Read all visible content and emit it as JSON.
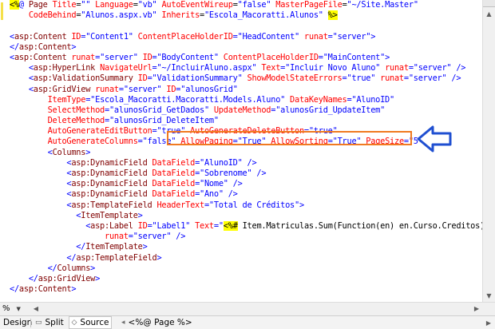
{
  "editor": {
    "lines": [
      [
        {
          "c": "del",
          "t": "<%"
        },
        {
          "c": "kw",
          "t": "@"
        },
        {
          "c": "txt",
          "t": " "
        },
        {
          "c": "tag",
          "t": "Page"
        },
        {
          "c": "txt",
          "t": " "
        },
        {
          "c": "attr",
          "t": "Title"
        },
        {
          "c": "txt",
          "t": "="
        },
        {
          "c": "val",
          "t": "\"\""
        },
        {
          "c": "txt",
          "t": " "
        },
        {
          "c": "attr",
          "t": "Language"
        },
        {
          "c": "txt",
          "t": "="
        },
        {
          "c": "val",
          "t": "\"vb\""
        },
        {
          "c": "txt",
          "t": " "
        },
        {
          "c": "attr",
          "t": "AutoEventWireup"
        },
        {
          "c": "txt",
          "t": "="
        },
        {
          "c": "val",
          "t": "\"false\""
        },
        {
          "c": "txt",
          "t": " "
        },
        {
          "c": "attr",
          "t": "MasterPageFile"
        },
        {
          "c": "txt",
          "t": "="
        },
        {
          "c": "val",
          "t": "\"~/Site.Master\""
        }
      ],
      [
        {
          "c": "txt",
          "t": "    "
        },
        {
          "c": "attr",
          "t": "CodeBehind"
        },
        {
          "c": "txt",
          "t": "="
        },
        {
          "c": "val",
          "t": "\"Alunos.aspx.vb\""
        },
        {
          "c": "txt",
          "t": " "
        },
        {
          "c": "attr",
          "t": "Inherits"
        },
        {
          "c": "txt",
          "t": "="
        },
        {
          "c": "val",
          "t": "\"Escola_Macoratti.Alunos\""
        },
        {
          "c": "txt",
          "t": " "
        },
        {
          "c": "del",
          "t": "%>"
        }
      ],
      [],
      [
        {
          "c": "kw",
          "t": "<"
        },
        {
          "c": "tag",
          "t": "asp:Content"
        },
        {
          "c": "txt",
          "t": " "
        },
        {
          "c": "attr",
          "t": "ID"
        },
        {
          "c": "kw",
          "t": "="
        },
        {
          "c": "val",
          "t": "\"Content1\""
        },
        {
          "c": "txt",
          "t": " "
        },
        {
          "c": "attr",
          "t": "ContentPlaceHolderID"
        },
        {
          "c": "kw",
          "t": "="
        },
        {
          "c": "val",
          "t": "\"HeadContent\""
        },
        {
          "c": "txt",
          "t": " "
        },
        {
          "c": "attr",
          "t": "runat"
        },
        {
          "c": "kw",
          "t": "="
        },
        {
          "c": "val",
          "t": "\"server\""
        },
        {
          "c": "kw",
          "t": ">"
        }
      ],
      [
        {
          "c": "kw",
          "t": "</"
        },
        {
          "c": "tag",
          "t": "asp:Content"
        },
        {
          "c": "kw",
          "t": ">"
        }
      ],
      [
        {
          "c": "kw",
          "t": "<"
        },
        {
          "c": "tag",
          "t": "asp:Content"
        },
        {
          "c": "txt",
          "t": " "
        },
        {
          "c": "attr",
          "t": "runat"
        },
        {
          "c": "kw",
          "t": "="
        },
        {
          "c": "val",
          "t": "\"server\""
        },
        {
          "c": "txt",
          "t": " "
        },
        {
          "c": "attr",
          "t": "ID"
        },
        {
          "c": "kw",
          "t": "="
        },
        {
          "c": "val",
          "t": "\"BodyContent\""
        },
        {
          "c": "txt",
          "t": " "
        },
        {
          "c": "attr",
          "t": "ContentPlaceHolderID"
        },
        {
          "c": "kw",
          "t": "="
        },
        {
          "c": "val",
          "t": "\"MainContent\""
        },
        {
          "c": "kw",
          "t": ">"
        }
      ],
      [
        {
          "c": "txt",
          "t": "    "
        },
        {
          "c": "kw",
          "t": "<"
        },
        {
          "c": "tag",
          "t": "asp:HyperLink"
        },
        {
          "c": "txt",
          "t": " "
        },
        {
          "c": "attr",
          "t": "NavigateUrl"
        },
        {
          "c": "kw",
          "t": "="
        },
        {
          "c": "val",
          "t": "\"~/IncluirAluno.aspx\""
        },
        {
          "c": "txt",
          "t": " "
        },
        {
          "c": "attr",
          "t": "Text"
        },
        {
          "c": "kw",
          "t": "="
        },
        {
          "c": "val",
          "t": "\"Incluir Novo Aluno\""
        },
        {
          "c": "txt",
          "t": " "
        },
        {
          "c": "attr",
          "t": "runat"
        },
        {
          "c": "kw",
          "t": "="
        },
        {
          "c": "val",
          "t": "\"server\""
        },
        {
          "c": "txt",
          "t": " "
        },
        {
          "c": "kw",
          "t": "/>"
        }
      ],
      [
        {
          "c": "txt",
          "t": "    "
        },
        {
          "c": "kw",
          "t": "<"
        },
        {
          "c": "tag",
          "t": "asp:ValidationSummary"
        },
        {
          "c": "txt",
          "t": " "
        },
        {
          "c": "attr",
          "t": "ID"
        },
        {
          "c": "kw",
          "t": "="
        },
        {
          "c": "val",
          "t": "\"ValidationSummary\""
        },
        {
          "c": "txt",
          "t": " "
        },
        {
          "c": "attr",
          "t": "ShowModelStateErrors"
        },
        {
          "c": "kw",
          "t": "="
        },
        {
          "c": "val",
          "t": "\"true\""
        },
        {
          "c": "txt",
          "t": " "
        },
        {
          "c": "attr",
          "t": "runat"
        },
        {
          "c": "kw",
          "t": "="
        },
        {
          "c": "val",
          "t": "\"server\""
        },
        {
          "c": "txt",
          "t": " "
        },
        {
          "c": "kw",
          "t": "/>"
        }
      ],
      [
        {
          "c": "txt",
          "t": "    "
        },
        {
          "c": "kw",
          "t": "<"
        },
        {
          "c": "tag",
          "t": "asp:GridView"
        },
        {
          "c": "txt",
          "t": " "
        },
        {
          "c": "attr",
          "t": "runat"
        },
        {
          "c": "kw",
          "t": "="
        },
        {
          "c": "val",
          "t": "\"server\""
        },
        {
          "c": "txt",
          "t": " "
        },
        {
          "c": "attr",
          "t": "ID"
        },
        {
          "c": "kw",
          "t": "="
        },
        {
          "c": "val",
          "t": "\"alunosGrid\""
        }
      ],
      [
        {
          "c": "txt",
          "t": "        "
        },
        {
          "c": "attr",
          "t": "ItemType"
        },
        {
          "c": "kw",
          "t": "="
        },
        {
          "c": "val",
          "t": "\"Escola_Macoratti.Macoratti.Models.Aluno\""
        },
        {
          "c": "txt",
          "t": " "
        },
        {
          "c": "attr",
          "t": "DataKeyNames"
        },
        {
          "c": "kw",
          "t": "="
        },
        {
          "c": "val",
          "t": "\"AlunoID\""
        }
      ],
      [
        {
          "c": "txt",
          "t": "        "
        },
        {
          "c": "attr",
          "t": "SelectMethod"
        },
        {
          "c": "kw",
          "t": "="
        },
        {
          "c": "val",
          "t": "\"alunosGrid_GetDados\""
        },
        {
          "c": "txt",
          "t": " "
        },
        {
          "c": "attr",
          "t": "UpdateMethod"
        },
        {
          "c": "kw",
          "t": "="
        },
        {
          "c": "val",
          "t": "\"alunosGrid_UpdateItem\""
        }
      ],
      [
        {
          "c": "txt",
          "t": "        "
        },
        {
          "c": "attr",
          "t": "DeleteMethod"
        },
        {
          "c": "kw",
          "t": "="
        },
        {
          "c": "val",
          "t": "\"alunosGrid_DeleteItem\""
        }
      ],
      [
        {
          "c": "txt",
          "t": "        "
        },
        {
          "c": "attr",
          "t": "AutoGenerateEditButton"
        },
        {
          "c": "kw",
          "t": "="
        },
        {
          "c": "val",
          "t": "\"true\""
        },
        {
          "c": "txt",
          "t": " "
        },
        {
          "c": "attr",
          "t": "AutoGenerateDeleteButton"
        },
        {
          "c": "kw",
          "t": "="
        },
        {
          "c": "val",
          "t": "\"true\""
        }
      ],
      [
        {
          "c": "txt",
          "t": "        "
        },
        {
          "c": "attr",
          "t": "AutoGenerateColumns"
        },
        {
          "c": "kw",
          "t": "="
        },
        {
          "c": "val",
          "t": "\"false\""
        },
        {
          "c": "txt",
          "t": " "
        },
        {
          "c": "attr",
          "t": "AllowPaging"
        },
        {
          "c": "kw",
          "t": "="
        },
        {
          "c": "val",
          "t": "\"True\""
        },
        {
          "c": "txt",
          "t": " "
        },
        {
          "c": "attr",
          "t": "AllowSorting"
        },
        {
          "c": "kw",
          "t": "="
        },
        {
          "c": "val",
          "t": "\"True\""
        },
        {
          "c": "txt",
          "t": " "
        },
        {
          "c": "attr",
          "t": "PageSize"
        },
        {
          "c": "kw",
          "t": "="
        },
        {
          "c": "val",
          "t": "\"5\""
        },
        {
          "c": "kw",
          "t": ">"
        }
      ],
      [
        {
          "c": "txt",
          "t": "        "
        },
        {
          "c": "kw",
          "t": "<"
        },
        {
          "c": "tag",
          "t": "Columns"
        },
        {
          "c": "kw",
          "t": ">"
        }
      ],
      [
        {
          "c": "txt",
          "t": "            "
        },
        {
          "c": "kw",
          "t": "<"
        },
        {
          "c": "tag",
          "t": "asp:DynamicField"
        },
        {
          "c": "txt",
          "t": " "
        },
        {
          "c": "attr",
          "t": "DataField"
        },
        {
          "c": "kw",
          "t": "="
        },
        {
          "c": "val",
          "t": "\"AlunoID\""
        },
        {
          "c": "txt",
          "t": " "
        },
        {
          "c": "kw",
          "t": "/>"
        }
      ],
      [
        {
          "c": "txt",
          "t": "            "
        },
        {
          "c": "kw",
          "t": "<"
        },
        {
          "c": "tag",
          "t": "asp:DynamicField"
        },
        {
          "c": "txt",
          "t": " "
        },
        {
          "c": "attr",
          "t": "DataField"
        },
        {
          "c": "kw",
          "t": "="
        },
        {
          "c": "val",
          "t": "\"Sobrenome\""
        },
        {
          "c": "txt",
          "t": " "
        },
        {
          "c": "kw",
          "t": "/>"
        }
      ],
      [
        {
          "c": "txt",
          "t": "            "
        },
        {
          "c": "kw",
          "t": "<"
        },
        {
          "c": "tag",
          "t": "asp:DynamicField"
        },
        {
          "c": "txt",
          "t": " "
        },
        {
          "c": "attr",
          "t": "DataField"
        },
        {
          "c": "kw",
          "t": "="
        },
        {
          "c": "val",
          "t": "\"Nome\""
        },
        {
          "c": "txt",
          "t": " "
        },
        {
          "c": "kw",
          "t": "/>"
        }
      ],
      [
        {
          "c": "txt",
          "t": "            "
        },
        {
          "c": "kw",
          "t": "<"
        },
        {
          "c": "tag",
          "t": "asp:DynamicField"
        },
        {
          "c": "txt",
          "t": " "
        },
        {
          "c": "attr",
          "t": "DataField"
        },
        {
          "c": "kw",
          "t": "="
        },
        {
          "c": "val",
          "t": "\"Ano\""
        },
        {
          "c": "txt",
          "t": " "
        },
        {
          "c": "kw",
          "t": "/>"
        }
      ],
      [
        {
          "c": "txt",
          "t": "            "
        },
        {
          "c": "kw",
          "t": "<"
        },
        {
          "c": "tag",
          "t": "asp:TemplateField"
        },
        {
          "c": "txt",
          "t": " "
        },
        {
          "c": "attr",
          "t": "HeaderText"
        },
        {
          "c": "kw",
          "t": "="
        },
        {
          "c": "val",
          "t": "\"Total de Créditos\""
        },
        {
          "c": "kw",
          "t": ">"
        }
      ],
      [
        {
          "c": "txt",
          "t": "              "
        },
        {
          "c": "kw",
          "t": "<"
        },
        {
          "c": "tag",
          "t": "ItemTemplate"
        },
        {
          "c": "kw",
          "t": ">"
        }
      ],
      [
        {
          "c": "txt",
          "t": "                "
        },
        {
          "c": "kw",
          "t": "<"
        },
        {
          "c": "tag",
          "t": "asp:Label"
        },
        {
          "c": "txt",
          "t": " "
        },
        {
          "c": "attr",
          "t": "ID"
        },
        {
          "c": "kw",
          "t": "="
        },
        {
          "c": "val",
          "t": "\"Label1\""
        },
        {
          "c": "txt",
          "t": " "
        },
        {
          "c": "attr",
          "t": "Text"
        },
        {
          "c": "kw",
          "t": "="
        },
        {
          "c": "val",
          "t": "\""
        },
        {
          "c": "del",
          "t": "<%#"
        },
        {
          "c": "txt",
          "t": " Item.Matriculas.Sum(Function(en) en.Curso.Creditos)"
        },
        {
          "c": "del",
          "t": "%>"
        },
        {
          "c": "val",
          "t": "\""
        }
      ],
      [
        {
          "c": "txt",
          "t": "                    "
        },
        {
          "c": "attr",
          "t": "runat"
        },
        {
          "c": "kw",
          "t": "="
        },
        {
          "c": "val",
          "t": "\"server\""
        },
        {
          "c": "txt",
          "t": " "
        },
        {
          "c": "kw",
          "t": "/>"
        }
      ],
      [
        {
          "c": "txt",
          "t": "              "
        },
        {
          "c": "kw",
          "t": "</"
        },
        {
          "c": "tag",
          "t": "ItemTemplate"
        },
        {
          "c": "kw",
          "t": ">"
        }
      ],
      [
        {
          "c": "txt",
          "t": "            "
        },
        {
          "c": "kw",
          "t": "</"
        },
        {
          "c": "tag",
          "t": "asp:TemplateField"
        },
        {
          "c": "kw",
          "t": ">"
        }
      ],
      [
        {
          "c": "txt",
          "t": "        "
        },
        {
          "c": "kw",
          "t": "</"
        },
        {
          "c": "tag",
          "t": "Columns"
        },
        {
          "c": "kw",
          "t": ">"
        }
      ],
      [
        {
          "c": "txt",
          "t": "    "
        },
        {
          "c": "kw",
          "t": "</"
        },
        {
          "c": "tag",
          "t": "asp:GridView"
        },
        {
          "c": "kw",
          "t": ">"
        }
      ],
      [
        {
          "c": "kw",
          "t": "</"
        },
        {
          "c": "tag",
          "t": "asp:Content"
        },
        {
          "c": "kw",
          "t": ">"
        }
      ]
    ]
  },
  "annotation": {
    "highlight_color": "#f07a21",
    "arrow_color": "#1f4fd1",
    "arrow_icon": "arrow-left-icon"
  },
  "statusbar": {
    "zoom": "%",
    "design": "Design",
    "split": "Split",
    "source": "Source",
    "breadcrumb": "<%@ Page %>"
  },
  "colors": {
    "tag": "#800000",
    "attribute": "#ff0000",
    "value": "#0000ff",
    "server_delimiter_bg": "#ffff00"
  }
}
